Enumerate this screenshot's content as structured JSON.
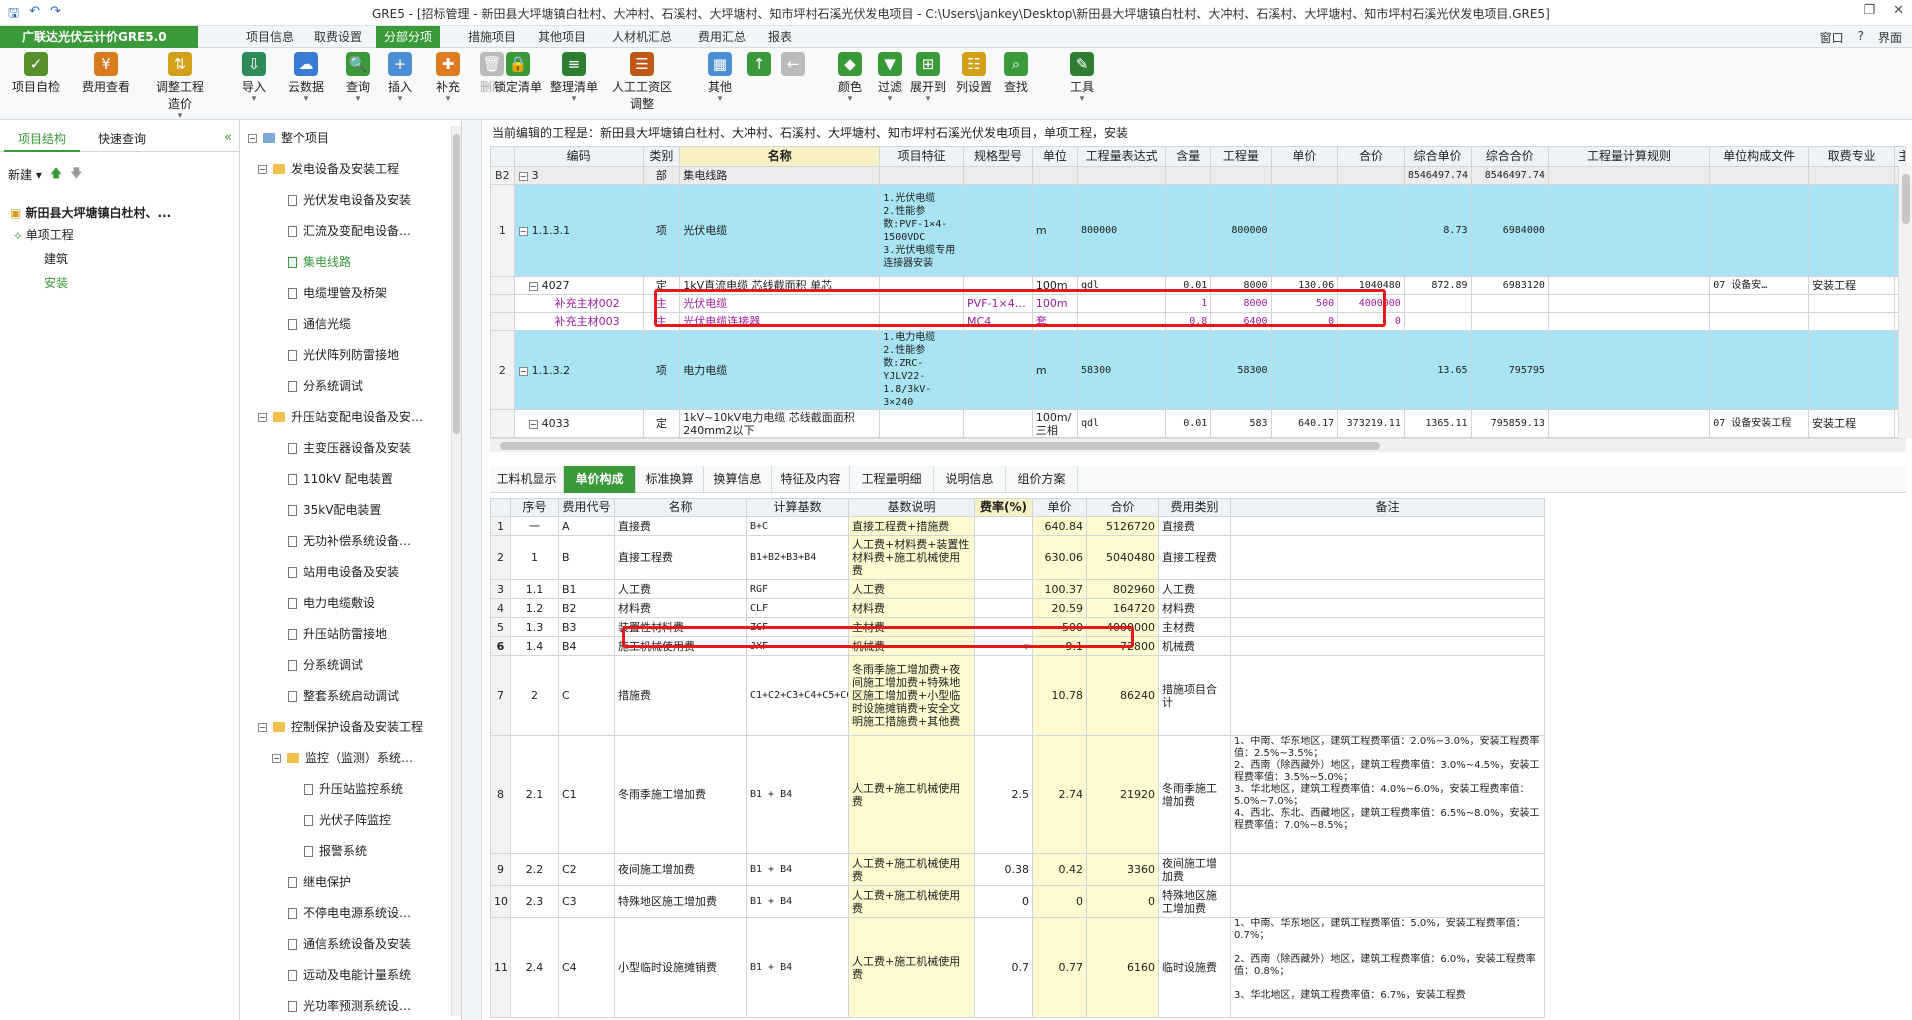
{
  "titlebar": {
    "title": "GRE5 - [招标管理 - 新田县大坪塘镇白杜村、大冲村、石溪村、大坪塘村、知市坪村石溪光伏发电项目 - C:\\Users\\jankey\\Desktop\\新田县大坪塘镇白杜村、大冲村、石溪村、大坪塘村、知市坪村石溪光伏发电项目.GRE5]",
    "qa_save": "🖫",
    "qa_undo": "↶",
    "qa_redo": "↷",
    "wc_restore": "❐",
    "wc_close": "✕"
  },
  "menubar": {
    "brand": "广联达光伏云计价GRE5.0",
    "items": [
      "项目信息",
      "取费设置",
      "分部分项",
      "措施项目",
      "其他项目",
      "人材机汇总",
      "费用汇总",
      "报表"
    ],
    "right": [
      "窗口",
      "?",
      "界面"
    ]
  },
  "ribbon": {
    "buttons": [
      {
        "label": "项目自检",
        "dd": "",
        "color": "#5a8f2e",
        "glyph": "✓"
      },
      {
        "label": "费用查看",
        "dd": "",
        "color": "#d97a1e",
        "glyph": "¥"
      },
      {
        "label": "调整工程",
        "label2": "造价",
        "dd": "▾",
        "color": "#d4a017",
        "glyph": "⇅"
      },
      {
        "label": "导入",
        "dd": "▾",
        "color": "#2e8b57",
        "glyph": "⇩"
      },
      {
        "label": "云数据",
        "dd": "▾",
        "color": "#3a7bd5",
        "glyph": "☁"
      },
      {
        "label": "查询",
        "dd": "▾",
        "color": "#3a9a3a",
        "glyph": "🔍"
      },
      {
        "label": "插入",
        "dd": "▾",
        "color": "#4a8fd4",
        "glyph": "+"
      },
      {
        "label": "补充",
        "dd": "▾",
        "color": "#e07b20",
        "glyph": "✚"
      },
      {
        "label": "删除",
        "dd": "",
        "color": "#bbbbbb",
        "glyph": "🗑"
      },
      {
        "label": "锁定清单",
        "dd": "",
        "color": "#3a9a3a",
        "glyph": "🔒"
      },
      {
        "label": "整理清单",
        "dd": "▾",
        "color": "#2e7d32",
        "glyph": "≡"
      },
      {
        "label": "人工工资区",
        "label2": "调整",
        "dd": "",
        "color": "#c2571a",
        "glyph": "☰"
      },
      {
        "label": "其他",
        "dd": "▾",
        "color": "#4a8fd4",
        "glyph": "▦"
      },
      {
        "label": "",
        "dd": "",
        "color": "#3a9a3a",
        "glyph": "↑"
      },
      {
        "label": "",
        "dd": "",
        "color": "#bbbbbb",
        "glyph": "←"
      },
      {
        "label": "颜色",
        "dd": "▾",
        "color": "#3a9a3a",
        "glyph": "◆"
      },
      {
        "label": "过滤",
        "dd": "▾",
        "color": "#3a9a3a",
        "glyph": "▼"
      },
      {
        "label": "展开到",
        "dd": "▾",
        "color": "#3a9a3a",
        "glyph": "⊞"
      },
      {
        "label": "列设置",
        "dd": "",
        "color": "#d4a017",
        "glyph": "☷"
      },
      {
        "label": "查找",
        "dd": "",
        "color": "#3a9a3a",
        "glyph": "⌕"
      },
      {
        "label": "工具",
        "dd": "▾",
        "color": "#2e7d32",
        "glyph": "✎"
      }
    ]
  },
  "leftpanel": {
    "tabs": [
      "项目结构",
      "快速查询"
    ],
    "new_label": "新建 ▾",
    "project": "新田县大坪塘镇白杜村、...",
    "single": "单项工程",
    "items": [
      "建筑",
      "安装"
    ]
  },
  "tree": {
    "items": [
      {
        "label": "整个项目",
        "level": 0,
        "kind": "root",
        "ex": "−"
      },
      {
        "label": "发电设备及安装工程",
        "level": 1,
        "kind": "folder",
        "ex": "−"
      },
      {
        "label": "光伏发电设备及安装",
        "level": 2,
        "kind": "doc"
      },
      {
        "label": "汇流及变配电设备…",
        "level": 2,
        "kind": "doc"
      },
      {
        "label": "集电线路",
        "level": 2,
        "kind": "doc",
        "sel": true
      },
      {
        "label": "电缆埋管及桥架",
        "level": 2,
        "kind": "doc"
      },
      {
        "label": "通信光缆",
        "level": 2,
        "kind": "doc"
      },
      {
        "label": "光伏阵列防雷接地",
        "level": 2,
        "kind": "doc"
      },
      {
        "label": "分系统调试",
        "level": 2,
        "kind": "doc"
      },
      {
        "label": "升压站变配电设备及安…",
        "level": 1,
        "kind": "folder",
        "ex": "−"
      },
      {
        "label": "主变压器设备及安装",
        "level": 2,
        "kind": "doc"
      },
      {
        "label": "110kV 配电装置",
        "level": 2,
        "kind": "doc"
      },
      {
        "label": "35kV配电装置",
        "level": 2,
        "kind": "doc"
      },
      {
        "label": "无功补偿系统设备…",
        "level": 2,
        "kind": "doc"
      },
      {
        "label": "站用电设备及安装",
        "level": 2,
        "kind": "doc"
      },
      {
        "label": "电力电缆敷设",
        "level": 2,
        "kind": "doc"
      },
      {
        "label": "升压站防雷接地",
        "level": 2,
        "kind": "doc"
      },
      {
        "label": "分系统调试",
        "level": 2,
        "kind": "doc"
      },
      {
        "label": "整套系统启动调试",
        "level": 2,
        "kind": "doc"
      },
      {
        "label": "控制保护设备及安装工程",
        "level": 1,
        "kind": "folder",
        "ex": "−"
      },
      {
        "label": "监控（监测）系统…",
        "level": 2,
        "kind": "folder",
        "ex": "−"
      },
      {
        "label": "升压站监控系统",
        "level": 3,
        "kind": "doc"
      },
      {
        "label": "光伏子阵监控",
        "level": 3,
        "kind": "doc"
      },
      {
        "label": "报警系统",
        "level": 3,
        "kind": "doc"
      },
      {
        "label": "继电保护",
        "level": 2,
        "kind": "doc"
      },
      {
        "label": "不停电电源系统设…",
        "level": 2,
        "kind": "doc"
      },
      {
        "label": "通信系统设备及安装",
        "level": 2,
        "kind": "doc"
      },
      {
        "label": "远动及电能计量系统",
        "level": 2,
        "kind": "doc"
      },
      {
        "label": "光功率预测系统设…",
        "level": 2,
        "kind": "doc"
      }
    ]
  },
  "main": {
    "breadcrumb": "当前编辑的工程是：新田县大坪塘镇白杜村、大冲村、石溪村、大坪塘村、知市坪村石溪光伏发电项目，单项工程，安装",
    "upper_headers": [
      "",
      "编码",
      "类别",
      "名称",
      "项目特征",
      "规格型号",
      "单位",
      "工程量表达式",
      "含量",
      "工程量",
      "单价",
      "合价",
      "综合单价",
      "综合合价",
      "工程量计算规则",
      "单位构成文件",
      "取费专业",
      "主"
    ],
    "upper_rows": [
      {
        "cls": "gray",
        "rn": "B2",
        "ex": "−",
        "code": "3",
        "type": "部",
        "name": "集电线路",
        "feat": "",
        "spec": "",
        "unit": "",
        "expr": "",
        "qty_ratio": "",
        "qty": "",
        "price": "",
        "total": "",
        "cprice": "8546497.74",
        "ctotal": "8546497.74",
        "rule": "",
        "file": "",
        "prof": ""
      },
      {
        "cls": "cyan tall",
        "rn": "1",
        "ex": "−",
        "code": "1.1.3.1",
        "type": "项",
        "name": "光伏电缆",
        "feat": "1.光伏电缆\n2.性能参数:PVF-1×4-1500VDC\n3.光伏电缆专用连接器安装",
        "spec": "",
        "unit": "m",
        "expr": "800000",
        "qty_ratio": "",
        "qty": "800000",
        "price": "",
        "total": "",
        "cprice": "8.73",
        "ctotal": "6984000",
        "rule": "",
        "file": "",
        "prof": ""
      },
      {
        "cls": "",
        "rn": "",
        "ex": "−",
        "code": "4027",
        "type": "定",
        "name": "1kV直流电缆 芯线截面积 单芯",
        "feat": "",
        "spec": "",
        "unit": "100m",
        "expr": "qdl",
        "qty_ratio": "0.01",
        "qty": "8000",
        "price": "130.06",
        "total": "1040480",
        "cprice": "872.89",
        "ctotal": "6983120",
        "rule": "",
        "file": "07 设备安…",
        "prof": "安装工程"
      },
      {
        "cls": "purple",
        "rn": "",
        "ex": "",
        "code": "补充主材002",
        "type": "主",
        "name": "光伏电缆",
        "feat": "",
        "spec": "PVF-1×4…",
        "unit": "100m",
        "expr": "",
        "qty_ratio": "1",
        "qty": "8000",
        "price": "500",
        "total": "4000000",
        "cprice": "",
        "ctotal": "",
        "rule": "",
        "file": "",
        "prof": ""
      },
      {
        "cls": "purple",
        "rn": "",
        "ex": "",
        "code": "补充主材003",
        "type": "主",
        "name": "光伏电缆连接器",
        "feat": "",
        "spec": "MC4",
        "unit": "套",
        "expr": "",
        "qty_ratio": "0.8",
        "qty": "6400",
        "price": "0",
        "total": "0",
        "cprice": "",
        "ctotal": "",
        "rule": "",
        "file": "",
        "prof": ""
      },
      {
        "cls": "cyan tall",
        "rn": "2",
        "ex": "−",
        "code": "1.1.3.2",
        "type": "项",
        "name": "电力电缆",
        "feat": "1.电力电缆\n2.性能参数:ZRC-YJLV22-1.8/3kV-3×240",
        "spec": "",
        "unit": "m",
        "expr": "58300",
        "qty_ratio": "",
        "qty": "58300",
        "price": "",
        "total": "",
        "cprice": "13.65",
        "ctotal": "795795",
        "rule": "",
        "file": "",
        "prof": ""
      },
      {
        "cls": "",
        "rn": "",
        "ex": "−",
        "code": "4033",
        "type": "定",
        "name": "1kV~10kV电力电缆 芯线截面面积240mm2以下",
        "feat": "",
        "spec": "",
        "unit": "100m/三相",
        "expr": "qdl",
        "qty_ratio": "0.01",
        "qty": "583",
        "price": "640.17",
        "total": "373219.11",
        "cprice": "1365.11",
        "ctotal": "795859.13",
        "rule": "",
        "file": "07 设备安装工程",
        "prof": "安装工程"
      }
    ],
    "bottom_tabs": [
      "工料机显示",
      "单价构成",
      "标准换算",
      "换算信息",
      "特征及内容",
      "工程量明细",
      "说明信息",
      "组价方案"
    ],
    "lower_headers": [
      "",
      "序号",
      "费用代号",
      "名称",
      "计算基数",
      "基数说明",
      "费率(%)",
      "单价",
      "合价",
      "费用类别",
      "备注"
    ],
    "lower_rows": [
      {
        "rn": "1",
        "seq": "一",
        "code": "A",
        "name": "直接费",
        "base": "B+C",
        "desc": "直接工程费+措施费",
        "rate": "",
        "price": "640.84",
        "total": "5126720",
        "cat": "直接费",
        "note": "",
        "h": 19
      },
      {
        "rn": "2",
        "seq": "1",
        "code": "B",
        "name": "直接工程费",
        "base": "B1+B2+B3+B4",
        "desc": "人工费+材料费+装置性材料费+施工机械使用费",
        "rate": "",
        "price": "630.06",
        "total": "5040480",
        "cat": "直接工程费",
        "note": "",
        "h": 44
      },
      {
        "rn": "3",
        "seq": "1.1",
        "code": "B1",
        "name": "人工费",
        "base": "RGF",
        "desc": "人工费",
        "rate": "",
        "price": "100.37",
        "total": "802960",
        "cat": "人工费",
        "note": "",
        "h": 19
      },
      {
        "rn": "4",
        "seq": "1.2",
        "code": "B2",
        "name": "材料费",
        "base": "CLF",
        "desc": "材料费",
        "rate": "",
        "price": "20.59",
        "total": "164720",
        "cat": "材料费",
        "note": "",
        "h": 19
      },
      {
        "rn": "5",
        "seq": "1.3",
        "code": "B3",
        "name": "装置性材料费",
        "base": "ZCF",
        "desc": "主材费",
        "rate": "",
        "price": "500",
        "total": "4000000",
        "cat": "主材费",
        "note": "",
        "h": 19
      },
      {
        "rn": "6",
        "seq": "1.4",
        "code": "B4",
        "name": "施工机械使用费",
        "base": "JXF",
        "desc": "机械费",
        "rate": "▾",
        "price": "9.1",
        "total": "72800",
        "cat": "机械费",
        "note": "",
        "h": 19,
        "bold": true
      },
      {
        "rn": "7",
        "seq": "2",
        "code": "C",
        "name": "措施费",
        "base": "C1+C2+C3+C4+C5+C6",
        "desc": "冬雨季施工增加费+夜间施工增加费+特殊地区施工增加费+小型临时设施摊销费+安全文明施工措施费+其他费",
        "rate": "",
        "price": "10.78",
        "total": "86240",
        "cat": "措施项目合计",
        "note": "",
        "h": 80
      },
      {
        "rn": "8",
        "seq": "2.1",
        "code": "C1",
        "name": "冬雨季施工增加费",
        "base": "B1 + B4",
        "desc": "人工费+施工机械使用费",
        "rate": "2.5",
        "price": "2.74",
        "total": "21920",
        "cat": "冬雨季施工增加费",
        "note": "1、中南、华东地区，建筑工程费率值：2.0%~3.0%，安装工程费率值：2.5%~3.5%；\n2、西南（除西藏外）地区，建筑工程费率值：3.0%~4.5%，安装工程费率值：3.5%~5.0%；\n3、华北地区，建筑工程费率值：4.0%~6.0%，安装工程费率值：5.0%~7.0%；\n4、西北、东北、西藏地区，建筑工程费率值：6.5%~8.0%，安装工程费率值：7.0%~8.5%；",
        "h": 118
      },
      {
        "rn": "9",
        "seq": "2.2",
        "code": "C2",
        "name": "夜间施工增加费",
        "base": "B1 + B4",
        "desc": "人工费+施工机械使用费",
        "rate": "0.38",
        "price": "0.42",
        "total": "3360",
        "cat": "夜间施工增加费",
        "note": "",
        "h": 32
      },
      {
        "rn": "10",
        "seq": "2.3",
        "code": "C3",
        "name": "特殊地区施工增加费",
        "base": "B1 + B4",
        "desc": "人工费+施工机械使用费",
        "rate": "0",
        "price": "0",
        "total": "0",
        "cat": "特殊地区施工增加费",
        "note": "",
        "h": 32
      },
      {
        "rn": "11",
        "seq": "2.4",
        "code": "C4",
        "name": "小型临时设施摊销费",
        "base": "B1 + B4",
        "desc": "人工费+施工机械使用费",
        "rate": "0.7",
        "price": "0.77",
        "total": "6160",
        "cat": "临时设施费",
        "note": "1、中南、华东地区，建筑工程费率值：5.0%，安装工程费率值：0.7%；\n\n2、西南（除西藏外）地区，建筑工程费率值：6.0%，安装工程费率值：0.8%；\n\n3、华北地区，建筑工程费率值：6.7%，安装工程费",
        "h": 100
      }
    ]
  }
}
